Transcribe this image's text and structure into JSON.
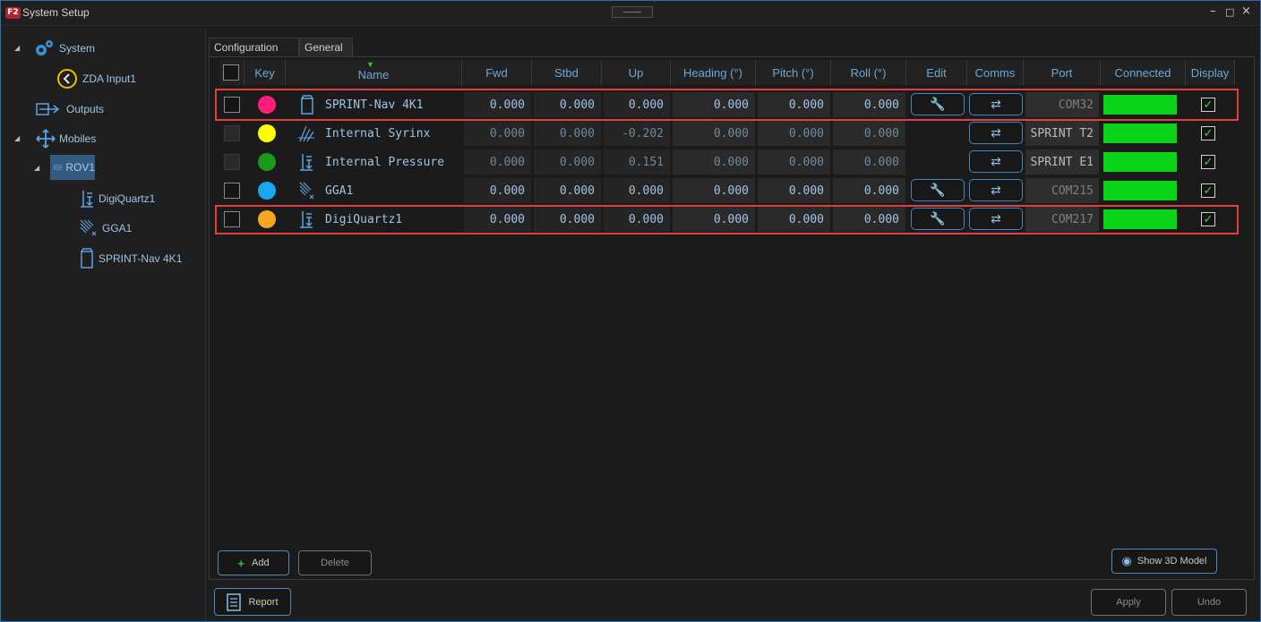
{
  "window": {
    "logo": "F2",
    "title": "System Setup",
    "controls": {
      "minimize": "–",
      "maximize": "□",
      "close": "×"
    }
  },
  "sidebar": {
    "items": [
      {
        "label": "System",
        "icon": "gear-icon"
      },
      {
        "label": "ZDA Input1",
        "icon": "clock-icon"
      },
      {
        "label": "Outputs",
        "icon": "output-icon"
      },
      {
        "label": "Mobiles",
        "icon": "move-arrows-icon"
      },
      {
        "label": "ROV1",
        "icon": "rov-icon"
      },
      {
        "label": "DigiQuartz1",
        "icon": "pressure-sensor-icon"
      },
      {
        "label": "GGA1",
        "icon": "gps-icon"
      },
      {
        "label": "SPRINT-Nav 4K1",
        "icon": "ins-icon"
      }
    ]
  },
  "tabs": [
    {
      "label": "Configuration",
      "active": true
    },
    {
      "label": "General",
      "active": false
    }
  ],
  "table": {
    "headers": [
      "Key",
      "Name",
      "Fwd",
      "Stbd",
      "Up",
      "Heading (°)",
      "Pitch (°)",
      "Roll (°)",
      "Edit",
      "Comms",
      "Port",
      "Connected",
      "Display"
    ],
    "rows": [
      {
        "selectable": true,
        "key_color": "#ff1e7a",
        "icon": "ins-icon",
        "name": "SPRINT-Nav 4K1",
        "fwd": "0.000",
        "stbd": "0.000",
        "up": "0.000",
        "heading": "0.000",
        "pitch": "0.000",
        "roll": "0.000",
        "has_edit": true,
        "port": "COM32",
        "connected": true,
        "display": true,
        "highlighted": true
      },
      {
        "selectable": false,
        "key_color": "#ffff00",
        "icon": "syrinx-icon",
        "name": "Internal Syrinx",
        "fwd": "0.000",
        "stbd": "0.000",
        "up": "-0.202",
        "heading": "0.000",
        "pitch": "0.000",
        "roll": "0.000",
        "has_edit": false,
        "port": "SPRINT T2",
        "connected": true,
        "display": true,
        "highlighted": false
      },
      {
        "selectable": false,
        "key_color": "#1a9a1a",
        "icon": "pressure-sensor-icon",
        "name": "Internal Pressure",
        "fwd": "0.000",
        "stbd": "0.000",
        "up": "0.151",
        "heading": "0.000",
        "pitch": "0.000",
        "roll": "0.000",
        "has_edit": false,
        "port": "SPRINT E1",
        "connected": true,
        "display": true,
        "highlighted": false
      },
      {
        "selectable": true,
        "key_color": "#1ba7ee",
        "icon": "gps-icon",
        "name": "GGA1",
        "fwd": "0.000",
        "stbd": "0.000",
        "up": "0.000",
        "heading": "0.000",
        "pitch": "0.000",
        "roll": "0.000",
        "has_edit": true,
        "port": "COM215",
        "connected": true,
        "display": true,
        "highlighted": false
      },
      {
        "selectable": true,
        "key_color": "#f5a623",
        "icon": "pressure-sensor-icon",
        "name": "DigiQuartz1",
        "fwd": "0.000",
        "stbd": "0.000",
        "up": "0.000",
        "heading": "0.000",
        "pitch": "0.000",
        "roll": "0.000",
        "has_edit": true,
        "port": "COM217",
        "connected": true,
        "display": true,
        "highlighted": true
      }
    ]
  },
  "buttons": {
    "add": "Add",
    "delete": "Delete",
    "show3d": "Show 3D Model",
    "report": "Report",
    "apply": "Apply",
    "undo": "Undo"
  },
  "colors": {
    "accent": "#3f86c6",
    "connected": "#0bd318",
    "highlight": "#e04040",
    "text_blue": "#9ec4e6"
  }
}
